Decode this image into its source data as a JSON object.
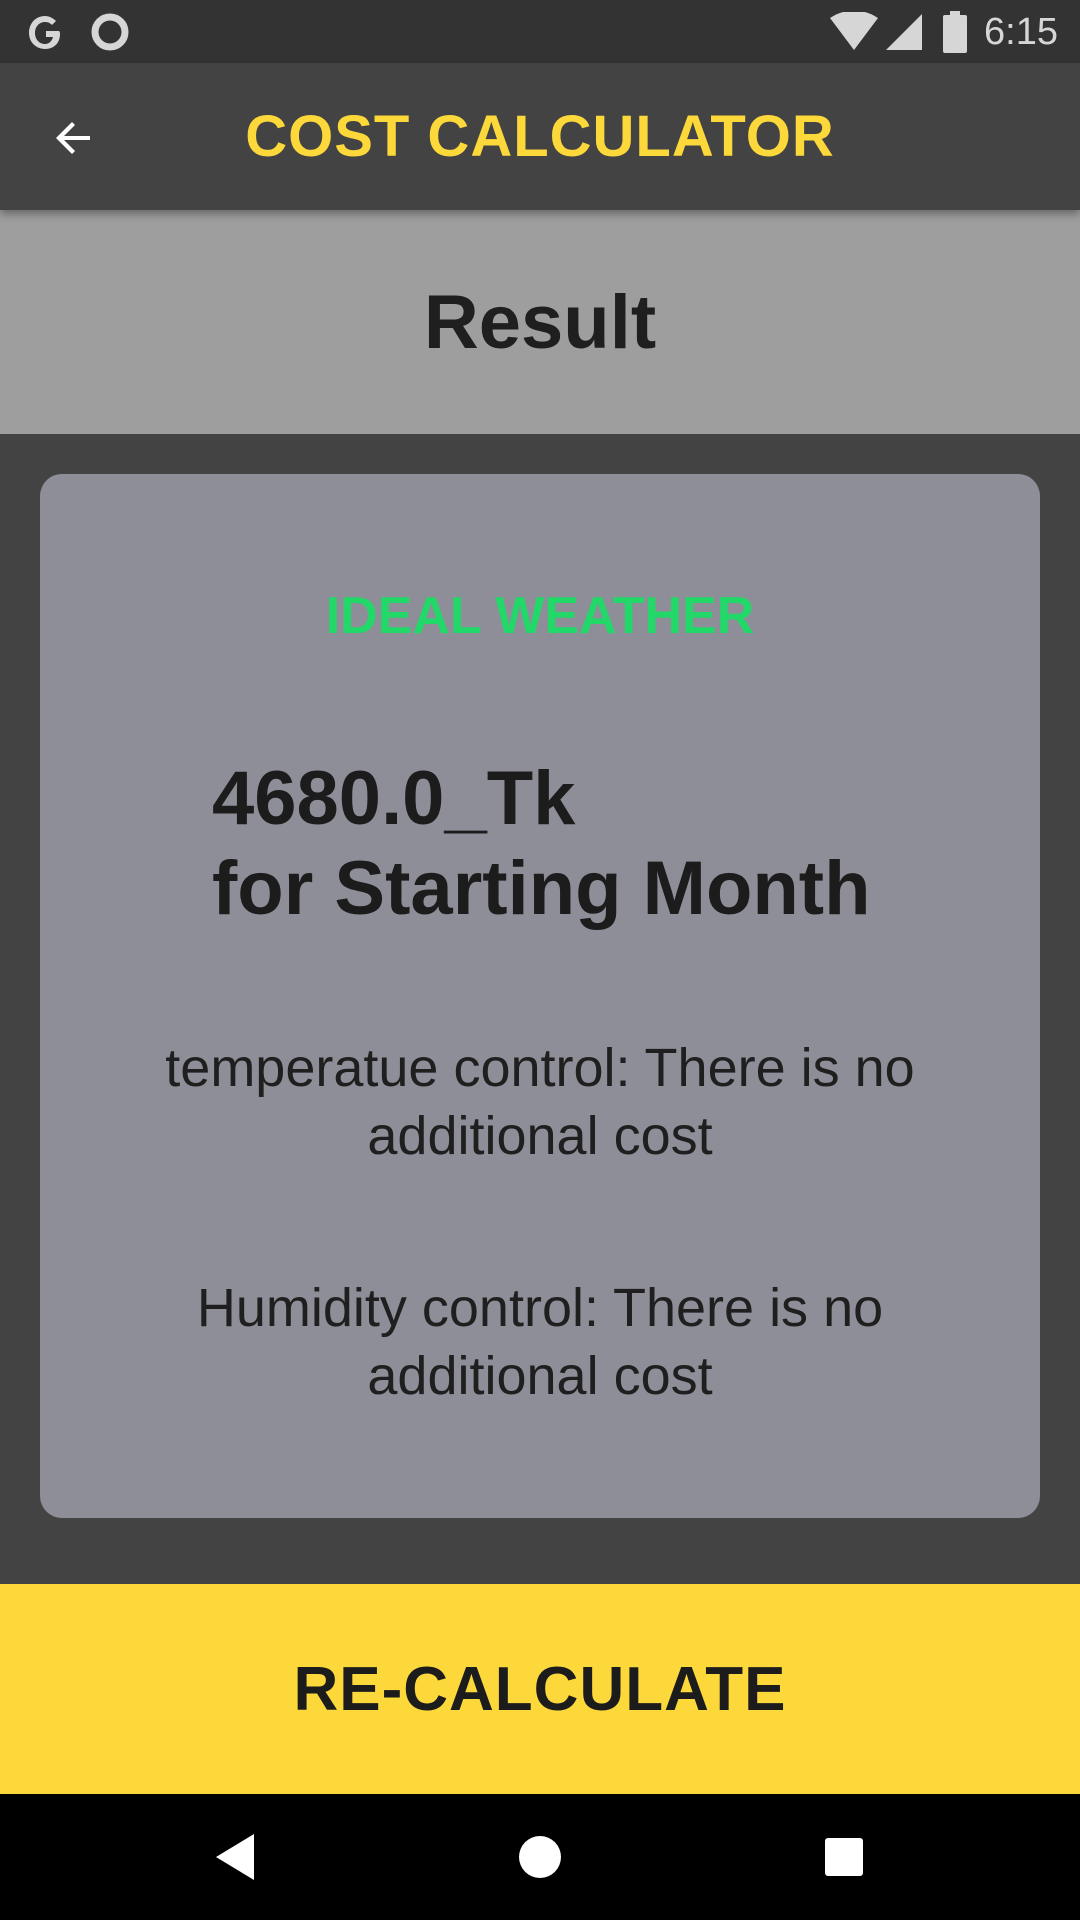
{
  "status_bar": {
    "time": "6:15",
    "icons": [
      "google-g-icon",
      "circle-notification-icon",
      "wifi-icon",
      "cell-signal-icon",
      "battery-icon"
    ]
  },
  "app_bar": {
    "title": "COST CALCULATOR",
    "back_icon": "arrow-back-icon"
  },
  "header": {
    "title": "Result"
  },
  "card": {
    "weather_label": "IDEAL WEATHER",
    "cost_amount": "4680.0_Tk",
    "cost_period": "for Starting Month",
    "temperature_note": "temperatue control: There is no additional cost",
    "humidity_note": "Humidity control: There is no additional cost"
  },
  "actions": {
    "recalculate_label": "RE-CALCULATE"
  },
  "nav_bar": {
    "icons": [
      "nav-back-icon",
      "nav-home-icon",
      "nav-recents-icon"
    ]
  },
  "colors": {
    "accent_yellow": "#fdd83b",
    "weather_green": "#22d868",
    "card_background": "#8e8e98",
    "header_band": "#9e9e9e",
    "app_background": "#434343"
  }
}
